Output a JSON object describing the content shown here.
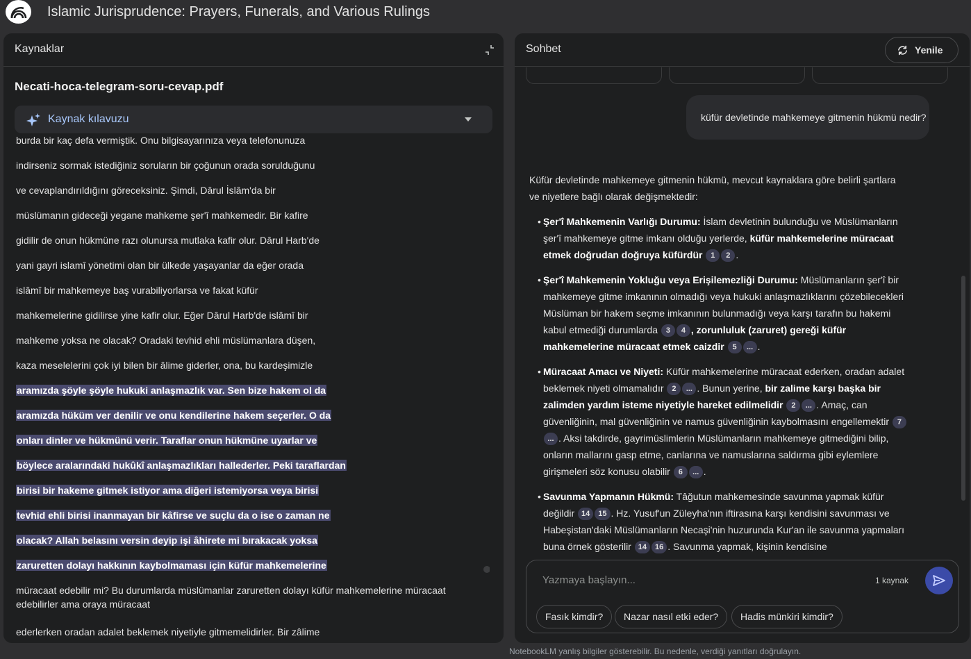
{
  "app": {
    "title": "Islamic Jurisprudence: Prayers, Funerals, and Various Rulings"
  },
  "sources": {
    "header": "Kaynaklar",
    "doc_name": "Necati-hoca-telegram-soru-cevap.pdf",
    "guide_label": "Kaynak kılavuzu",
    "lines": [
      "burda bir kaç defa vermiştik. Onu bilgisayarınıza veya telefonunuza",
      "indirseniz sormak istediğiniz soruların bir çoğunun orada sorulduğunu",
      "ve cevaplandırıldığını göreceksiniz. Şimdi, Dârul İslâm'da bir",
      "müslümanın gideceği yegane mahkeme şer'î mahkemedir. Bir kafire",
      "gidilir de onun hükmüne razı olunursa mutlaka kafir olur. Dârul Harb'de",
      "yani gayri islamî yönetimi olan bir ülkede yaşayanlar da eğer orada",
      "islâmî bir mahkemeye baş vurabiliyorlarsa ve fakat küfür",
      "mahkemelerine gidilirse yine kafir olur. Eğer Dârul Harb'de islâmî bir",
      "mahkeme yoksa ne olacak? Oradaki tevhid ehli müslümanlara düşen,",
      "kaza meselelerini çok iyi bilen bir âlime giderler, ona, bu kardeşimizle"
    ],
    "highlighted": [
      "aramızda şöyle şöyle hukuki anlaşmazlık var. Sen bize hakem ol da",
      "aramızda hüküm ver denilir ve onu kendilerine hakem seçerler. O da",
      "onları dinler ve hükmünü verir. Taraflar onun hükmüne uyarlar ve",
      "böylece aralarındaki hukûkî anlaşmazlıkları hallederler. Peki taraflardan",
      "birisi bir hakeme gitmek istiyor ama diğeri istemiyorsa veya birisi",
      "tevhid ehli birisi inanmayan bir kâfirse ve suçlu da o ise o zaman ne",
      "olacak? Allah belasını versin deyip işi âhirete mi bırakacak yoksa",
      "zaruretten dolayı hakkının kaybolmaması için küfür mahkemelerine"
    ],
    "tail_wrap": "müracaat edebilir mi? Bu durumlarda müslümanlar zaruretten dolayı küfür mahkemelerine müracaat edebilirler ama oraya müracaat",
    "tail_last": "ederlerken oradan adalet beklemek niyetiyle gitmemelidirler. Bir zâlime"
  },
  "chat": {
    "header": "Sohbet",
    "refresh_label": "Yenile",
    "user_question": "küfür devletinde mahkemeye gitmenin hükmü nedir?",
    "intro": "Küfür devletinde mahkemeye gitmenin hükmü, mevcut kaynaklara göre belirli şartlara ve niyetlere bağlı olarak değişmektedir:",
    "b1_title": "Şer'î Mahkemenin Varlığı Durumu:",
    "b1_text": " İslam devletinin bulunduğu ve Müslümanların şer'î mahkemeye gitme imkanı olduğu yerlerde, ",
    "b1_bold": "küfür mahkemelerine müracaat etmek doğrudan doğruya küfürdür",
    "b2_title": "Şer'î Mahkemenin Yokluğu veya Erişilemezliği Durumu:",
    "b2_text": " Müslümanların şer'î bir mahkemeye gitme imkanının olmadığı veya hukuki anlaşmazlıklarını çözebilecekleri Müslüman bir hakem seçme imkanının bulunmadığı veya karşı tarafın bu hakemi kabul etmediği durumlarda ",
    "b2_bold": ", zorunluluk (zaruret) gereği küfür mahkemelerine müracaat etmek caizdir",
    "b3_title": "Müracaat Amacı ve Niyeti:",
    "b3_text1": " Küfür mahkemelerine müracaat ederken, oradan adalet beklemek niyeti olmamalıdır ",
    "b3_text2": ". Bunun yerine, ",
    "b3_bold": "bir zalime karşı başka bir zalimden yardım isteme niyetiyle hareket edilmelidir",
    "b3_text3": ". Amaç, can güvenliğinin, mal güvenliğinin ve namus güvenliğinin kaybolmasını engellemektir",
    "b3_text4": ". Aksi takdirde, gayrimüslimlerin Müslümanların mahkemeye gitmediğini bilip, onların mallarını gasp etme, canlarına ve namuslarına saldırma gibi eylemlere girişmeleri söz konusu olabilir",
    "b4_title": "Savunma Yapmanın Hükmü:",
    "b4_text1": " Tâğutun mahkemesinde savunma yapmak küfür değildir ",
    "b4_text2": ". Hz. Yusuf'un Züleyha'nın iftirasına karşı kendisini savunması ve Habeşistan'daki Müslümanların Necaşi'nin huzurunda Kur'an ile savunma yapmaları buna örnek gösterilir ",
    "b4_text3": ". Savunma yapmak, kişinin kendisine",
    "cites": {
      "c1": "1",
      "c2": "2",
      "c3": "3",
      "c4": "4",
      "c5": "5",
      "c6": "6",
      "c7": "7",
      "c14": "14",
      "c15": "15",
      "c16": "16",
      "more": "..."
    },
    "composer_placeholder": "Yazmaya başlayın...",
    "source_count": "1 kaynak",
    "suggestions": [
      "Fasık kimdir?",
      "Nazar nasıl etki eder?",
      "Hadis münkiri kimdir?"
    ]
  },
  "disclaimer": "NotebookLM yanlış bilgiler gösterebilir. Bu nedenle, verdiği yanıtları doğrulayın."
}
